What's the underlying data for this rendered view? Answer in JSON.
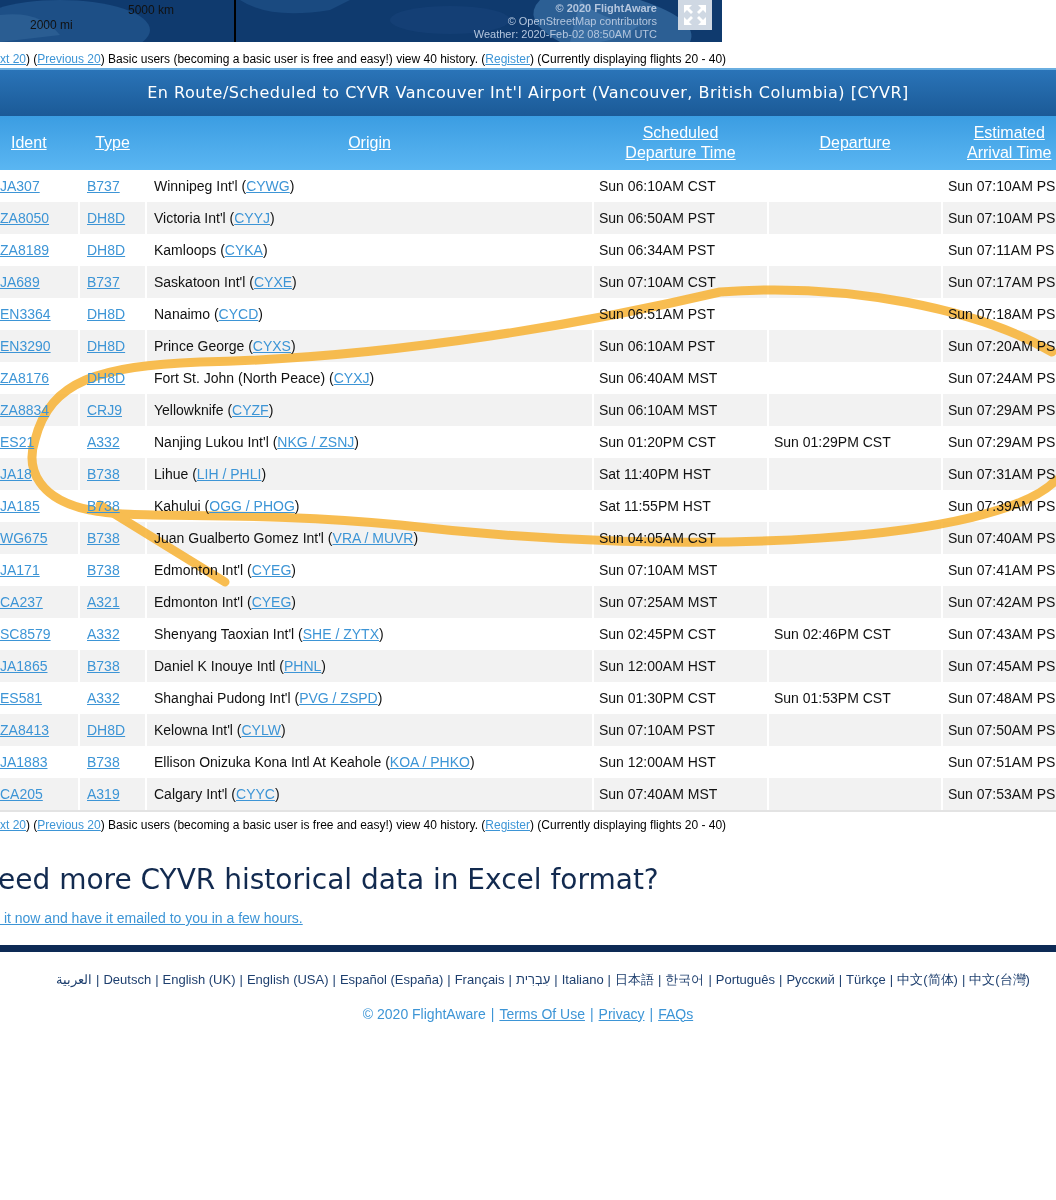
{
  "map": {
    "scale": [
      "5000 km",
      "2000 mi"
    ],
    "attribution": [
      "© 2020 FlightAware",
      "© OpenStreetMap contributors",
      "Weather: 2020-Feb-02 08:50AM UTC"
    ]
  },
  "pagination_top": [
    {
      "kind": "link",
      "text": "xt 20"
    },
    {
      "kind": "text",
      "text": ") ("
    },
    {
      "kind": "link",
      "text": "Previous 20"
    },
    {
      "kind": "text",
      "text": ") Basic users (becoming a basic user is free and easy!) view 40 history. ("
    },
    {
      "kind": "link",
      "text": "Register"
    },
    {
      "kind": "text",
      "text": ") (Currently displaying flights 20 - 40)"
    }
  ],
  "table": {
    "title": "En Route/Scheduled to CYVR Vancouver Int'l Airport (Vancouver, British Columbia) [CYVR]",
    "columns": [
      {
        "lines": [
          "Ident"
        ]
      },
      {
        "lines": [
          "Type"
        ]
      },
      {
        "lines": [
          "Origin"
        ]
      },
      {
        "lines": [
          "Scheduled",
          "Departure Time"
        ]
      },
      {
        "lines": [
          "Departure"
        ]
      },
      {
        "lines": [
          "Estimated",
          "Arrival Time"
        ]
      }
    ],
    "rows": [
      {
        "ident": "JA307",
        "type": "B737",
        "origin": {
          "before": "Winnipeg Int'l (",
          "code": "CYWG",
          "after": ")"
        },
        "scheduled": "Sun 06:10AM CST",
        "departure": "",
        "estimated": "Sun 07:10AM PS"
      },
      {
        "ident": "ZA8050",
        "type": "DH8D",
        "origin": {
          "before": "Victoria Int'l (",
          "code": "CYYJ",
          "after": ")"
        },
        "scheduled": "Sun 06:50AM PST",
        "departure": "",
        "estimated": "Sun 07:10AM PS"
      },
      {
        "ident": "ZA8189",
        "type": "DH8D",
        "origin": {
          "before": "Kamloops (",
          "code": "CYKA",
          "after": ")"
        },
        "scheduled": "Sun 06:34AM PST",
        "departure": "",
        "estimated": "Sun 07:11AM PS"
      },
      {
        "ident": "JA689",
        "type": "B737",
        "origin": {
          "before": "Saskatoon Int'l (",
          "code": "CYXE",
          "after": ")"
        },
        "scheduled": "Sun 07:10AM CST",
        "departure": "",
        "estimated": "Sun 07:17AM PS"
      },
      {
        "ident": "EN3364",
        "type": "DH8D",
        "origin": {
          "before": "Nanaimo (",
          "code": "CYCD",
          "after": ")"
        },
        "scheduled": "Sun 06:51AM PST",
        "departure": "",
        "estimated": "Sun 07:18AM PS"
      },
      {
        "ident": "EN3290",
        "type": "DH8D",
        "origin": {
          "before": "Prince George (",
          "code": "CYXS",
          "after": ")"
        },
        "scheduled": "Sun 06:10AM PST",
        "departure": "",
        "estimated": "Sun 07:20AM PS"
      },
      {
        "ident": "ZA8176",
        "type": "DH8D",
        "origin": {
          "before": "Fort St. John (North Peace) (",
          "code": "CYXJ",
          "after": ")"
        },
        "scheduled": "Sun 06:40AM MST",
        "departure": "",
        "estimated": "Sun 07:24AM PS"
      },
      {
        "ident": "ZA8834",
        "type": "CRJ9",
        "origin": {
          "before": "Yellowknife (",
          "code": "CYZF",
          "after": ")"
        },
        "scheduled": "Sun 06:10AM MST",
        "departure": "",
        "estimated": "Sun 07:29AM PS"
      },
      {
        "ident": "ES21",
        "type": "A332",
        "origin": {
          "before": "Nanjing Lukou Int'l (",
          "code": "NKG / ZSNJ",
          "after": ")"
        },
        "scheduled": "Sun 01:20PM CST",
        "departure": "Sun 01:29PM CST",
        "estimated": "Sun 07:29AM PS"
      },
      {
        "ident": "JA18",
        "type": "B738",
        "origin": {
          "before": "Lihue (",
          "code": "LIH / PHLI",
          "after": ")"
        },
        "scheduled": "Sat 11:40PM HST",
        "departure": "",
        "estimated": "Sun 07:31AM PS"
      },
      {
        "ident": "JA185",
        "type": "B738",
        "origin": {
          "before": "Kahului (",
          "code": "OGG / PHOG",
          "after": ")"
        },
        "scheduled": "Sat 11:55PM HST",
        "departure": "",
        "estimated": "Sun 07:39AM PS"
      },
      {
        "ident": "WG675",
        "type": "B738",
        "origin": {
          "before": "Juan Gualberto Gomez Int'l (",
          "code": "VRA / MUVR",
          "after": ")"
        },
        "scheduled": "Sun 04:05AM CST",
        "departure": "",
        "estimated": "Sun 07:40AM PS"
      },
      {
        "ident": "JA171",
        "type": "B738",
        "origin": {
          "before": "Edmonton Int'l (",
          "code": "CYEG",
          "after": ")"
        },
        "scheduled": "Sun 07:10AM MST",
        "departure": "",
        "estimated": "Sun 07:41AM PS"
      },
      {
        "ident": "CA237",
        "type": "A321",
        "origin": {
          "before": "Edmonton Int'l (",
          "code": "CYEG",
          "after": ")"
        },
        "scheduled": "Sun 07:25AM MST",
        "departure": "",
        "estimated": "Sun 07:42AM PS"
      },
      {
        "ident": "SC8579",
        "type": "A332",
        "origin": {
          "before": "Shenyang Taoxian Int'l (",
          "code": "SHE / ZYTX",
          "after": ")"
        },
        "scheduled": "Sun 02:45PM CST",
        "departure": "Sun 02:46PM CST",
        "estimated": "Sun 07:43AM PS"
      },
      {
        "ident": "JA1865",
        "type": "B738",
        "origin": {
          "before": "Daniel K Inouye Intl (",
          "code": "PHNL",
          "after": ")"
        },
        "scheduled": "Sun 12:00AM HST",
        "departure": "",
        "estimated": "Sun 07:45AM PS"
      },
      {
        "ident": "ES581",
        "type": "A332",
        "origin": {
          "before": "Shanghai Pudong Int'l (",
          "code": "PVG / ZSPD",
          "after": ")"
        },
        "scheduled": "Sun 01:30PM CST",
        "departure": "Sun 01:53PM CST",
        "estimated": "Sun 07:48AM PS"
      },
      {
        "ident": "ZA8413",
        "type": "DH8D",
        "origin": {
          "before": "Kelowna Int'l (",
          "code": "CYLW",
          "after": ")"
        },
        "scheduled": "Sun 07:10AM PST",
        "departure": "",
        "estimated": "Sun 07:50AM PS"
      },
      {
        "ident": "JA1883",
        "type": "B738",
        "origin": {
          "before": "Ellison Onizuka Kona Intl At Keahole (",
          "code": "KOA / PHKO",
          "after": ")"
        },
        "scheduled": "Sun 12:00AM HST",
        "departure": "",
        "estimated": "Sun 07:51AM PS"
      },
      {
        "ident": "CA205",
        "type": "A319",
        "origin": {
          "before": "Calgary Int'l (",
          "code": "CYYC",
          "after": ")"
        },
        "scheduled": "Sun 07:40AM MST",
        "departure": "",
        "estimated": "Sun 07:53AM PS"
      }
    ]
  },
  "pagination_bottom": [
    {
      "kind": "link",
      "text": "xt 20"
    },
    {
      "kind": "text",
      "text": ") ("
    },
    {
      "kind": "link",
      "text": "Previous 20"
    },
    {
      "kind": "text",
      "text": ") Basic users (becoming a basic user is free and easy!) view 40 history. ("
    },
    {
      "kind": "link",
      "text": "Register"
    },
    {
      "kind": "text",
      "text": ") (Currently displaying flights 20 - 40)"
    }
  ],
  "excel": {
    "heading": "eed more CYVR historical data in Excel format?",
    "link": " it now and have it emailed to you in a few hours."
  },
  "footer": {
    "separator": "|",
    "languages": [
      "العربية",
      "Deutsch",
      "English (UK)",
      "English (USA)",
      "Español (España)",
      "Français",
      "עִבְרִית",
      "Italiano",
      "日本語",
      "한국어",
      "Português",
      "Русский",
      "Türkçe",
      "中文(简体)",
      "中文(台灣)"
    ],
    "copyright": "© 2020 FlightAware",
    "links": [
      "Terms Of Use",
      "Privacy",
      "FAQs"
    ]
  }
}
